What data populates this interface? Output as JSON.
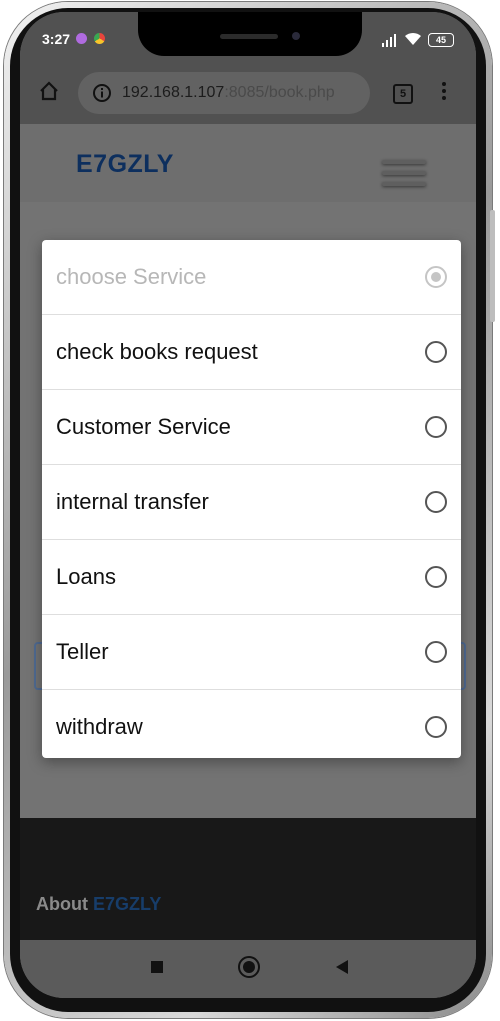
{
  "status": {
    "time": "3:27",
    "battery": "45"
  },
  "browser": {
    "url_host": "192.168.1.107",
    "url_rest": ":8085/book.php",
    "tab_count": "5"
  },
  "site": {
    "brand": "E7GZLY",
    "footer_about": "About",
    "footer_brand": "E7GZLY"
  },
  "dialog": {
    "options": [
      {
        "label": "choose Service",
        "disabled": true
      },
      {
        "label": "check books request"
      },
      {
        "label": "Customer Service"
      },
      {
        "label": "internal transfer"
      },
      {
        "label": "Loans"
      },
      {
        "label": "Teller"
      },
      {
        "label": "withdraw"
      }
    ]
  }
}
